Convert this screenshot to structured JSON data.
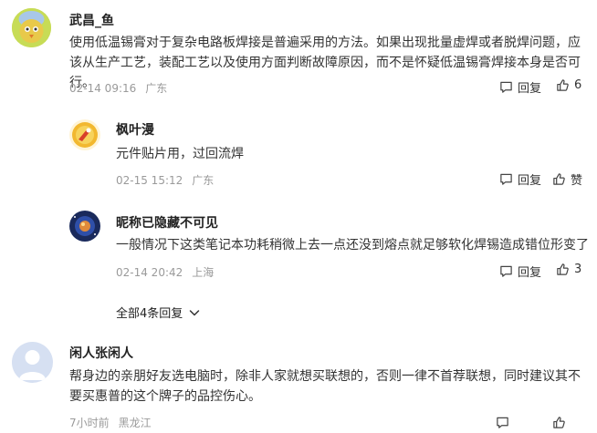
{
  "comments": [
    {
      "username": "武昌_鱼",
      "text": "使用低温锡膏对于复杂电路板焊接是普遍采用的方法。如果出现批量虚焊或者脱焊问题，应该从生产工艺，装配工艺以及使用方面判断故障原因，而不是怀疑低温锡膏焊接本身是否可行。",
      "date": "02-14 09:16",
      "location": "广东",
      "reply_label": "回复",
      "like_label": "6",
      "avatar_icon": "bird-cartoon-avatar"
    },
    {
      "username": "枫叶漫",
      "text": "元件贴片用，过回流焊",
      "date": "02-15 15:12",
      "location": "广东",
      "reply_label": "回复",
      "like_label": "赞",
      "avatar_icon": "gold-emblem-avatar"
    },
    {
      "username": "昵称已隐藏不可见",
      "text": "一般情况下这类笔记本功耗稍微上去一点还没到熔点就足够软化焊锡造成错位形变了",
      "date": "02-14 20:42",
      "location": "上海",
      "reply_label": "回复",
      "like_label": "3",
      "avatar_icon": "planet-avatar"
    },
    {
      "username": "闲人张闲人",
      "text": "帮身边的亲朋好友选电脑时，除非人家就想买联想的，否则一律不首荐联想，同时建议其不要买惠普的这个牌子的品控伤心。",
      "date": "7小时前",
      "location": "黑龙江",
      "avatar_icon": "default-user-avatar"
    }
  ],
  "expand_replies": {
    "label": "全部4条回复"
  },
  "colors": {
    "meta": "#9a9a9a",
    "text": "#333333",
    "icon": "#444444"
  }
}
